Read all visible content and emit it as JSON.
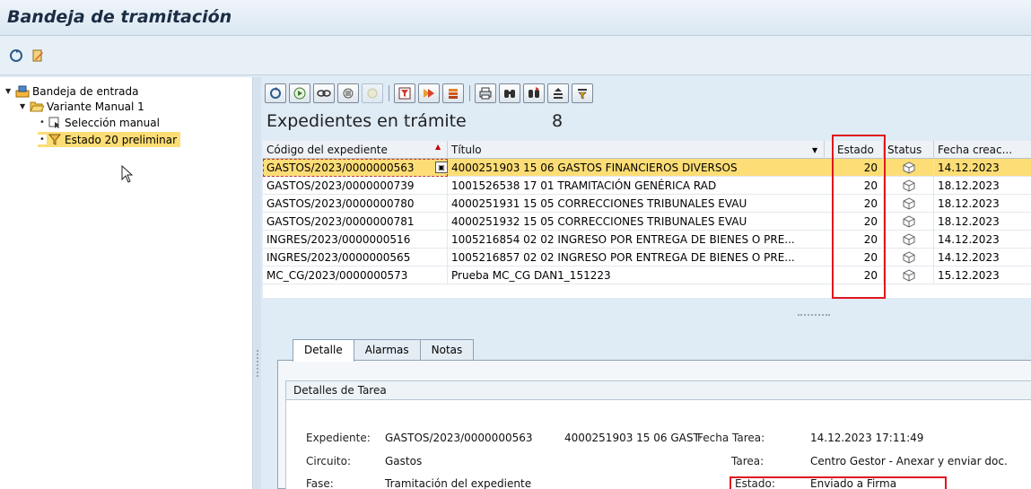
{
  "title": "Bandeja de tramitación",
  "tree": {
    "root": "Bandeja de entrada",
    "variant": "Variante Manual 1",
    "items": [
      "Selección manual",
      "Estado 20 preliminar"
    ]
  },
  "list": {
    "title": "Expedientes en trámite",
    "count": "8",
    "columns": [
      "Código del expediente",
      "Título",
      "Estado",
      "Status",
      "Fecha creac..."
    ],
    "rows": [
      {
        "code": "GASTOS/2023/0000000563",
        "title": "4000251903 15 06 GASTOS FINANCIEROS DIVERSOS",
        "estado": "20",
        "date": "14.12.2023"
      },
      {
        "code": "GASTOS/2023/0000000739",
        "title": "1001526538 17 01 TRAMITACIÓN GENÉRICA RAD",
        "estado": "20",
        "date": "18.12.2023"
      },
      {
        "code": "GASTOS/2023/0000000780",
        "title": "4000251931 15 05 CORRECCIONES TRIBUNALES EVAU",
        "estado": "20",
        "date": "18.12.2023"
      },
      {
        "code": "GASTOS/2023/0000000781",
        "title": "4000251932 15 05 CORRECCIONES TRIBUNALES EVAU",
        "estado": "20",
        "date": "18.12.2023"
      },
      {
        "code": "INGRES/2023/0000000516",
        "title": "1005216854 02 02 INGRESO POR ENTREGA DE BIENES O PRE...",
        "estado": "20",
        "date": "14.12.2023"
      },
      {
        "code": "INGRES/2023/0000000565",
        "title": "1005216857 02 02 INGRESO POR ENTREGA DE BIENES O PRE...",
        "estado": "20",
        "date": "14.12.2023"
      },
      {
        "code": "MC_CG/2023/0000000573",
        "title": "Prueba MC_CG DAN1_151223",
        "estado": "20",
        "date": "15.12.2023"
      }
    ]
  },
  "tabs": [
    "Detalle",
    "Alarmas",
    "Notas"
  ],
  "details": {
    "group_title": "Detalles de Tarea",
    "expediente_label": "Expediente:",
    "expediente_value": "GASTOS/2023/0000000563",
    "expediente_extra": "4000251903 15 06 GASTO",
    "circuito_label": "Circuito:",
    "circuito_value": "Gastos",
    "fase_label": "Fase:",
    "fase_value": "Tramitación del expediente",
    "fecha_label": "Fecha Tarea:",
    "fecha_value": "14.12.2023 17:11:49",
    "tarea_label": "Tarea:",
    "tarea_value": "Centro Gestor - Anexar y enviar doc.",
    "estado_label": "Estado:",
    "estado_value": "Enviado a Firma"
  },
  "colors": {
    "selection": "#fddd76",
    "highlight": "#e0161f",
    "background": "#dfebf5"
  }
}
